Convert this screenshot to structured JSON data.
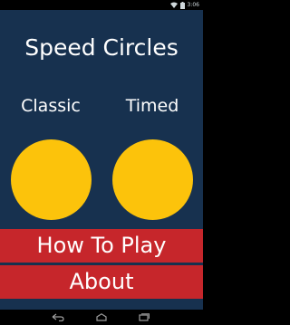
{
  "status_bar": {
    "time": "3:06",
    "icons": [
      "wifi-icon",
      "battery-icon"
    ],
    "text_color": "#cfd8dc"
  },
  "app": {
    "title": "Speed Circles",
    "background_color": "#17314f",
    "modes": [
      {
        "label": "Classic",
        "circle_color": "#fcc30b"
      },
      {
        "label": "Timed",
        "circle_color": "#fcc30b"
      }
    ],
    "menu": {
      "how_to_play_label": "How To Play",
      "about_label": "About",
      "button_color": "#c6262b"
    }
  },
  "nav_bar": {
    "buttons": [
      "back-icon",
      "home-icon",
      "recents-icon"
    ]
  }
}
